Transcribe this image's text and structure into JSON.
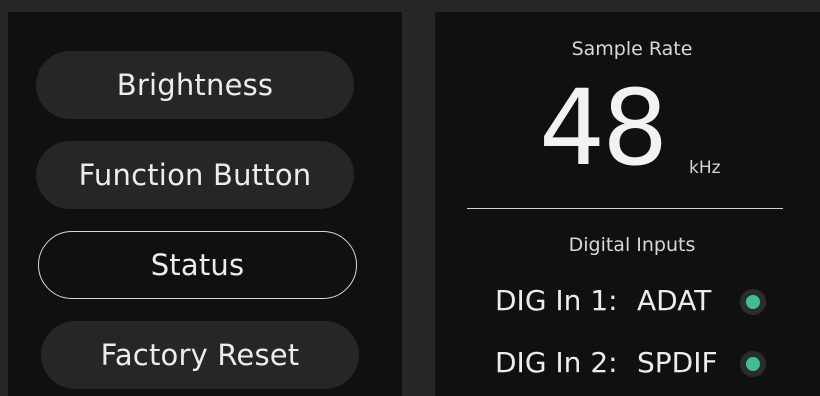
{
  "menu": {
    "items": [
      {
        "label": "Brightness",
        "selected": false
      },
      {
        "label": "Function Button",
        "selected": false
      },
      {
        "label": "Status",
        "selected": true
      },
      {
        "label": "Factory Reset",
        "selected": false
      }
    ]
  },
  "status": {
    "sample_rate_label": "Sample Rate",
    "sample_rate_value": "48",
    "sample_rate_unit": "kHz",
    "digital_inputs_label": "Digital Inputs",
    "inputs": [
      {
        "name": "DIG In 1:",
        "value": "ADAT",
        "indicator": "green-led-icon"
      },
      {
        "name": "DIG In 2:",
        "value": "SPDIF",
        "indicator": "green-led-icon"
      }
    ]
  },
  "colors": {
    "background": "#262626",
    "panel": "#101010",
    "button": "#262626",
    "led_active": "#3fbf8f"
  }
}
